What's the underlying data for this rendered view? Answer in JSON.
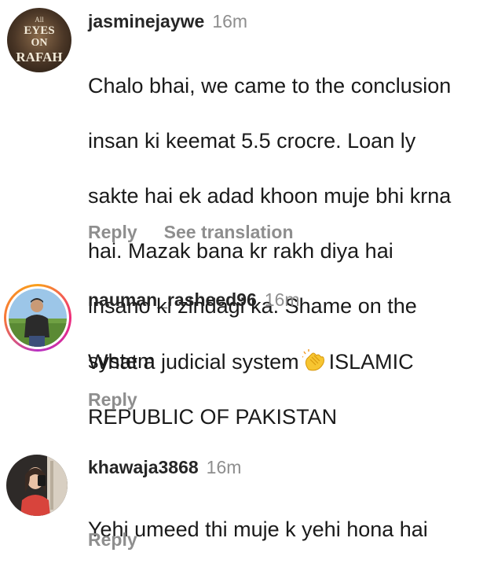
{
  "comments": [
    {
      "username": "jasminejaywe",
      "time": "16m",
      "avatar_text": [
        "All",
        "EYES",
        "ON",
        "RAFAH"
      ],
      "text_lines": [
        "Chalo bhai, we came to the conclusion",
        "insan ki keemat 5.5 crocre.  Loan ly",
        "sakte hai ek adad khoon muje bhi krna",
        "hai. Mazak bana kr rakh diya hai",
        "insano ki zindagi ka. Shame on the",
        "system"
      ],
      "reply_label": "Reply",
      "translate_label": "See translation"
    },
    {
      "username": "nauman_rasheed96",
      "time": "16m",
      "text_before_emoji": "What a judicial system",
      "emoji": "clapping-hands-icon",
      "text_after_emoji": "ISLAMIC",
      "text_line2": "REPUBLIC OF PAKISTAN",
      "reply_label": "Reply"
    },
    {
      "username": "khawaja3868",
      "time": "16m",
      "text": "Yehi umeed thi muje k yehi hona hai",
      "reply_label": "Reply"
    }
  ],
  "colors": {
    "username": "#262626",
    "meta": "#8e8e8e",
    "text": "#1a1a1a",
    "story_ring": [
      "#f9a01b",
      "#ee2a7b",
      "#b832c4"
    ]
  }
}
